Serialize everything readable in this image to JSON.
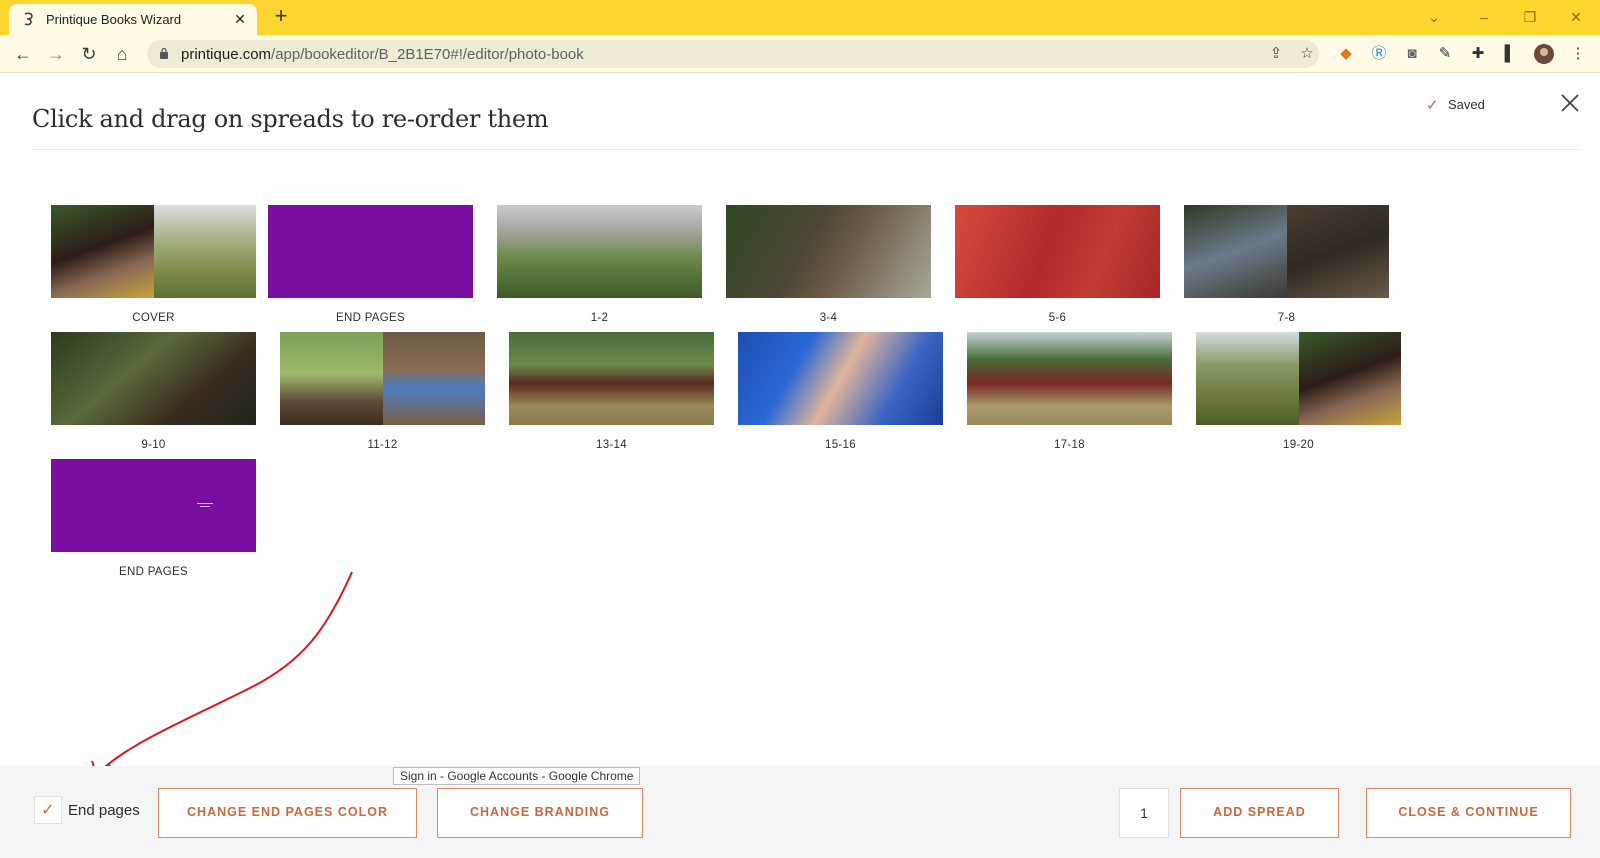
{
  "browser": {
    "tab_title": "Printique Books Wizard",
    "url_host": "printique.com",
    "url_path": "/app/bookeditor/B_2B1E70#!/editor/photo-book"
  },
  "editor": {
    "heading": "Click and drag on spreads to re-order them",
    "saved_label": "Saved"
  },
  "spreads": [
    {
      "label": "COVER"
    },
    {
      "label": "END PAGES"
    },
    {
      "label": "1-2"
    },
    {
      "label": "3-4"
    },
    {
      "label": "5-6"
    },
    {
      "label": "7-8"
    },
    {
      "label": "9-10"
    },
    {
      "label": "11-12"
    },
    {
      "label": "13-14"
    },
    {
      "label": "15-16"
    },
    {
      "label": "17-18"
    },
    {
      "label": "19-20"
    },
    {
      "label": "END PAGES"
    }
  ],
  "colors": {
    "accent": "#c9683f",
    "end_pages": "#7a0ea3",
    "chrome_frame": "#fcd62f"
  },
  "footer": {
    "end_pages_label": "End pages",
    "end_pages_checked": true,
    "change_color_label": "CHANGE END PAGES COLOR",
    "change_branding_label": "CHANGE BRANDING",
    "spread_count": "1",
    "add_spread_label": "ADD SPREAD",
    "close_continue_label": "CLOSE & CONTINUE"
  },
  "taskbar_tooltip": "Sign in - Google Accounts - Google Chrome"
}
